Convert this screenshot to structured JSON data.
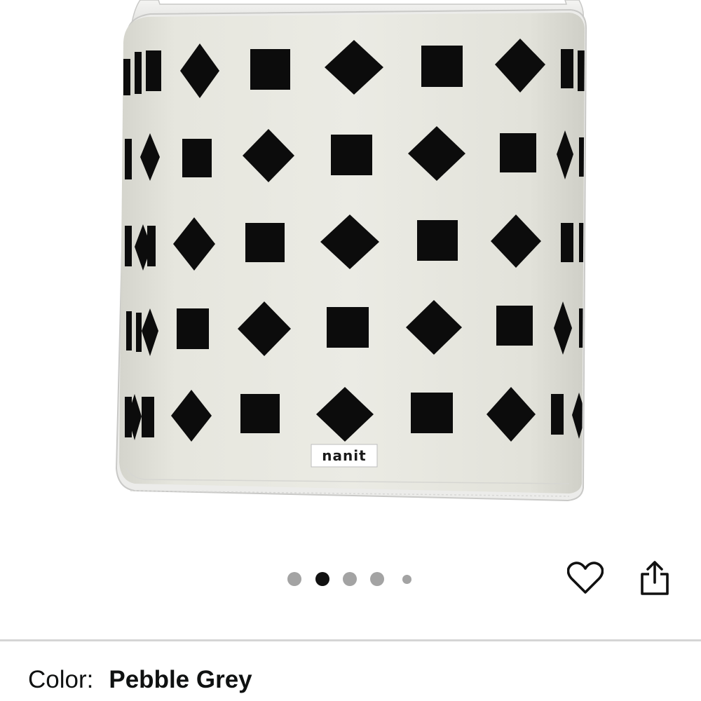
{
  "product": {
    "brand_tag": "nanit",
    "image_alt": "Nanit breathing wear band with black diamond and square pattern"
  },
  "carousel": {
    "total_images": 5,
    "active_index": 2
  },
  "actions": {
    "wishlist": "heart-icon",
    "share": "share-icon"
  },
  "color": {
    "label": "Color:",
    "value": "Pebble Grey"
  },
  "colors": {
    "fabric": "#e4e4dc",
    "binding": "#ebebeb",
    "pattern": "#0c0c0c",
    "active_dot": "#111111",
    "inactive_dot": "#a3a3a3",
    "divider": "#d5d5d5"
  }
}
